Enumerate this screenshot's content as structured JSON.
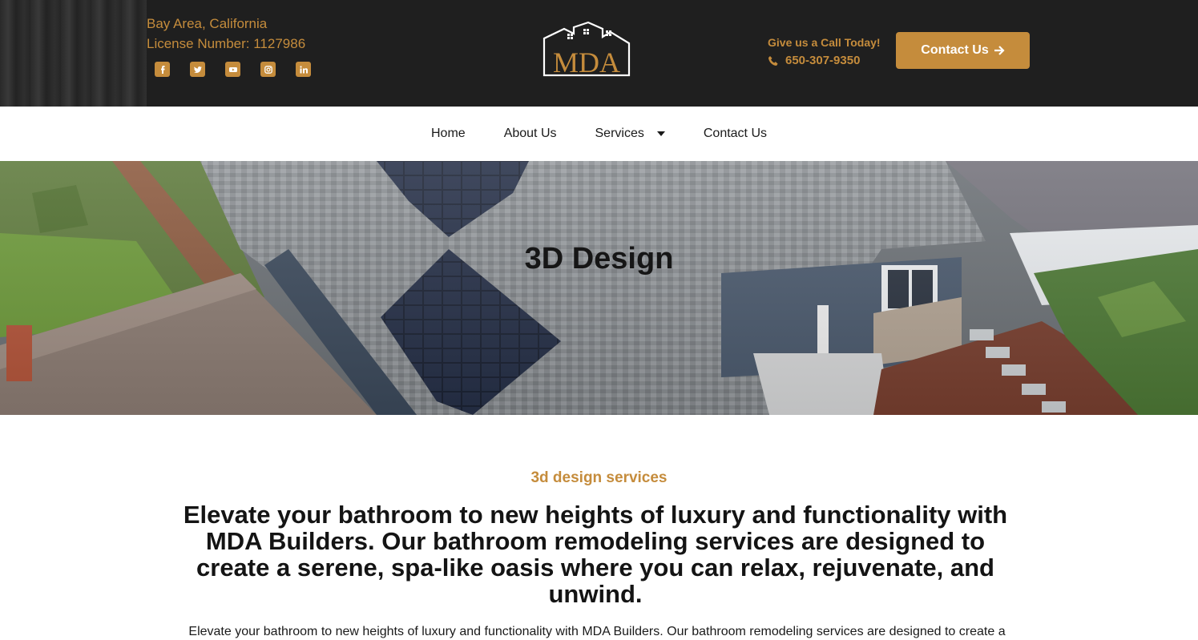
{
  "header": {
    "location": "Bay Area, California",
    "license": "License Number: 1127986",
    "socials": [
      "facebook-icon",
      "twitter-icon",
      "youtube-icon",
      "instagram-icon",
      "linkedin-icon"
    ],
    "logo_text": "MDA",
    "call_title": "Give us a Call Today!",
    "phone": "650-307-9350",
    "contact_button": "Contact Us"
  },
  "nav": {
    "items": [
      "Home",
      "About Us",
      "Services",
      "Contact Us"
    ]
  },
  "hero": {
    "title": "3D Design"
  },
  "content": {
    "eyebrow": "3d design services",
    "headline": "Elevate your bathroom to new heights of luxury and functionality with MDA Builders. Our bathroom remodeling services are designed to create a serene, spa-like oasis where you can relax, rejuvenate, and unwind.",
    "body": "Elevate your bathroom to new heights of luxury and functionality with MDA Builders. Our bathroom remodeling services are designed to create a"
  },
  "colors": {
    "accent": "#c58c3c",
    "topbar": "#1f1f1f"
  }
}
